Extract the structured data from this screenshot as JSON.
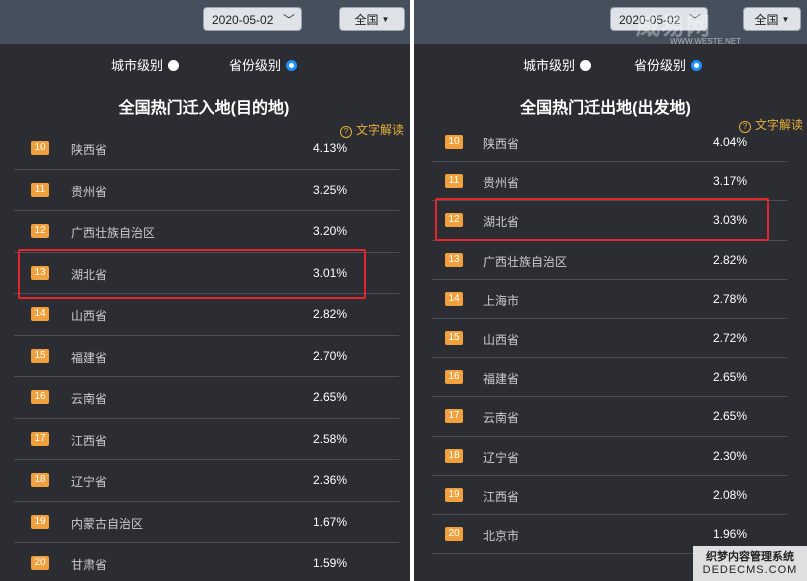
{
  "left": {
    "date": "2020-05-02",
    "scope": "全国",
    "city_level": "城市级别",
    "province_level": "省份级别",
    "title": "全国热门迁入地(目的地)",
    "note": "文字解读",
    "rows": [
      {
        "rank": "10",
        "name": "陕西省",
        "pct": "4.13%"
      },
      {
        "rank": "11",
        "name": "贵州省",
        "pct": "3.25%"
      },
      {
        "rank": "12",
        "name": "广西壮族自治区",
        "pct": "3.20%"
      },
      {
        "rank": "13",
        "name": "湖北省",
        "pct": "3.01%"
      },
      {
        "rank": "14",
        "name": "山西省",
        "pct": "2.82%"
      },
      {
        "rank": "15",
        "name": "福建省",
        "pct": "2.70%"
      },
      {
        "rank": "16",
        "name": "云南省",
        "pct": "2.65%"
      },
      {
        "rank": "17",
        "name": "江西省",
        "pct": "2.58%"
      },
      {
        "rank": "18",
        "name": "辽宁省",
        "pct": "2.36%"
      },
      {
        "rank": "19",
        "name": "内蒙古自治区",
        "pct": "1.67%"
      },
      {
        "rank": "20",
        "name": "甘肃省",
        "pct": "1.59%"
      }
    ]
  },
  "right": {
    "date": "2020-05-02",
    "scope": "全国",
    "city_level": "城市级别",
    "province_level": "省份级别",
    "title": "全国热门迁出地(出发地)",
    "note": "文字解读",
    "rows": [
      {
        "rank": "10",
        "name": "陕西省",
        "pct": "4.04%"
      },
      {
        "rank": "11",
        "name": "贵州省",
        "pct": "3.17%"
      },
      {
        "rank": "12",
        "name": "湖北省",
        "pct": "3.03%"
      },
      {
        "rank": "13",
        "name": "广西壮族自治区",
        "pct": "2.82%"
      },
      {
        "rank": "14",
        "name": "上海市",
        "pct": "2.78%"
      },
      {
        "rank": "15",
        "name": "山西省",
        "pct": "2.72%"
      },
      {
        "rank": "16",
        "name": "福建省",
        "pct": "2.65%"
      },
      {
        "rank": "17",
        "name": "云南省",
        "pct": "2.65%"
      },
      {
        "rank": "18",
        "name": "辽宁省",
        "pct": "2.30%"
      },
      {
        "rank": "19",
        "name": "江西省",
        "pct": "2.08%"
      },
      {
        "rank": "20",
        "name": "北京市",
        "pct": "1.96%"
      }
    ]
  },
  "watermark": {
    "logo_text": "威易网",
    "logo_url": "WWW.WESTE.NET",
    "footer_line1": "织梦内容管理系统",
    "footer_line2": "DEDECMS.COM"
  },
  "colors": {
    "panel_bg": "#2b2d32",
    "topbar_bg": "#46505d",
    "rank_badge": "#f0a03c",
    "highlight_box": "#e3262b",
    "note_text": "#e7b03a",
    "radio_selected": "#1e90ff"
  }
}
